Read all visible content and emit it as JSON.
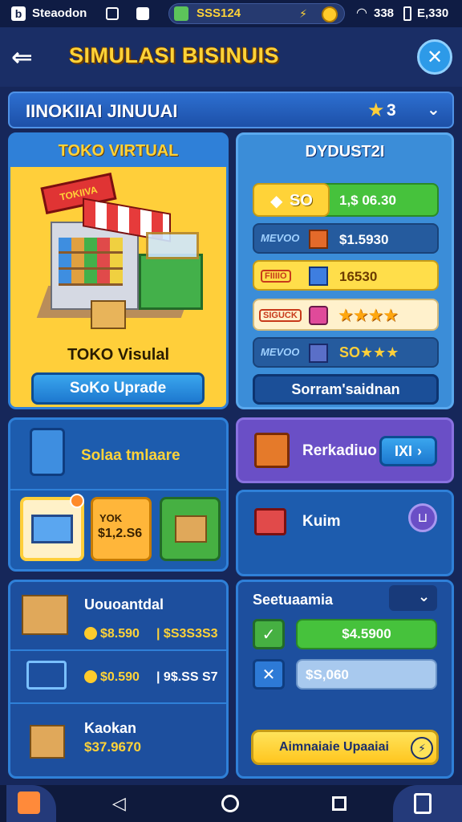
{
  "status_bar": {
    "left_app": "Steaodon",
    "left_icon_char": "b",
    "coins": "SSS124",
    "signal_text": "338",
    "battery_text": "E,330"
  },
  "header": {
    "title": "SIMULASI BISINUIS"
  },
  "subheader": {
    "label": "IINOKIIAI JINUUAI",
    "stars": "3"
  },
  "toko_panel": {
    "title": "TOKO VIRTUAL",
    "shop_sign": "TOKIIVA",
    "shop_name": "TOKO Visulal",
    "upgrade_button": "SoKo Uprade"
  },
  "stats_panel": {
    "title": "DYDUST2I",
    "rows": [
      {
        "left": "SO",
        "right": "1,$ 06.30"
      },
      {
        "left": "MEVOO",
        "right": "$1.5930"
      },
      {
        "left": "FIIIIO",
        "right": "16530"
      },
      {
        "left": "SIGUCK",
        "right": "★★★★"
      },
      {
        "left": "MEVOO",
        "right": "SO★★★"
      }
    ],
    "button": "Sorram'saidnan"
  },
  "inventory_panel": {
    "title": "Solaa tmlaare",
    "item_price_label": "YOK",
    "item_price": "$1,2.S6"
  },
  "market_panel": {
    "label": "Rerkadiuo",
    "button": "IXI"
  },
  "kuim_panel": {
    "label": "Kuim"
  },
  "list_panel": {
    "rows": [
      {
        "title": "Uouoantdal",
        "value1": "$8.590",
        "value2": "| $S3S3S3"
      },
      {
        "title": "",
        "value1": "$0.590",
        "value2": "| 9$.SS S7"
      },
      {
        "title": "Kaokan",
        "value1": "$37.9670",
        "value2": ""
      }
    ]
  },
  "settings_panel": {
    "label": "Seetuaamia",
    "price_1": "$4.5900",
    "price_2": "$S,060",
    "action_button": "Aimnaiaie Upaaiai"
  },
  "colors": {
    "background": "#16275a",
    "accent_yellow": "#ffcf3a",
    "accent_blue": "#2f80d8",
    "accent_green": "#46c23c",
    "accent_purple": "#6a4fc6"
  }
}
